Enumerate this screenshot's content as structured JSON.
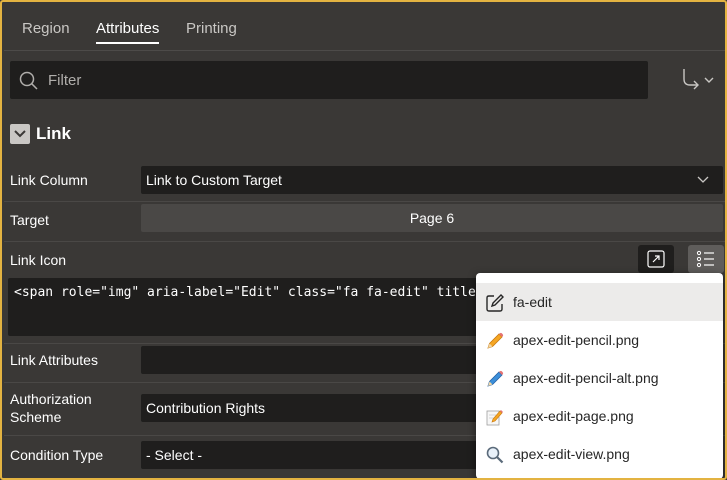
{
  "tabs": [
    {
      "label": "Region",
      "active": false
    },
    {
      "label": "Attributes",
      "active": true
    },
    {
      "label": "Printing",
      "active": false
    }
  ],
  "filter": {
    "placeholder": "Filter",
    "value": ""
  },
  "section": {
    "title": "Link",
    "expanded": true
  },
  "properties": {
    "link_column": {
      "label": "Link Column",
      "value": "Link to Custom Target"
    },
    "target": {
      "label": "Target",
      "value": "Page 6"
    },
    "link_icon": {
      "label": "Link Icon",
      "value": "<span role=\"img\" aria-label=\"Edit\" class=\"fa fa-edit\" title="
    },
    "link_attributes": {
      "label": "Link Attributes",
      "value": ""
    },
    "authorization_scheme": {
      "label": "Authorization Scheme",
      "value": "Contribution Rights"
    },
    "condition_type": {
      "label": "Condition Type",
      "value": "- Select -"
    }
  },
  "icon_popup": {
    "items": [
      {
        "label": "fa-edit",
        "icon": "edit-square-icon",
        "selected": true
      },
      {
        "label": "apex-edit-pencil.png",
        "icon": "pencil-icon",
        "selected": false
      },
      {
        "label": "apex-edit-pencil-alt.png",
        "icon": "pencil-blue-icon",
        "selected": false
      },
      {
        "label": "apex-edit-page.png",
        "icon": "edit-page-icon",
        "selected": false
      },
      {
        "label": "apex-edit-view.png",
        "icon": "magnifier-icon",
        "selected": false
      }
    ]
  },
  "colors": {
    "accent_border": "#e3b341",
    "panel_bg": "#3a3836",
    "field_bg": "#1f1e1d",
    "popup_bg": "#ffffff"
  }
}
